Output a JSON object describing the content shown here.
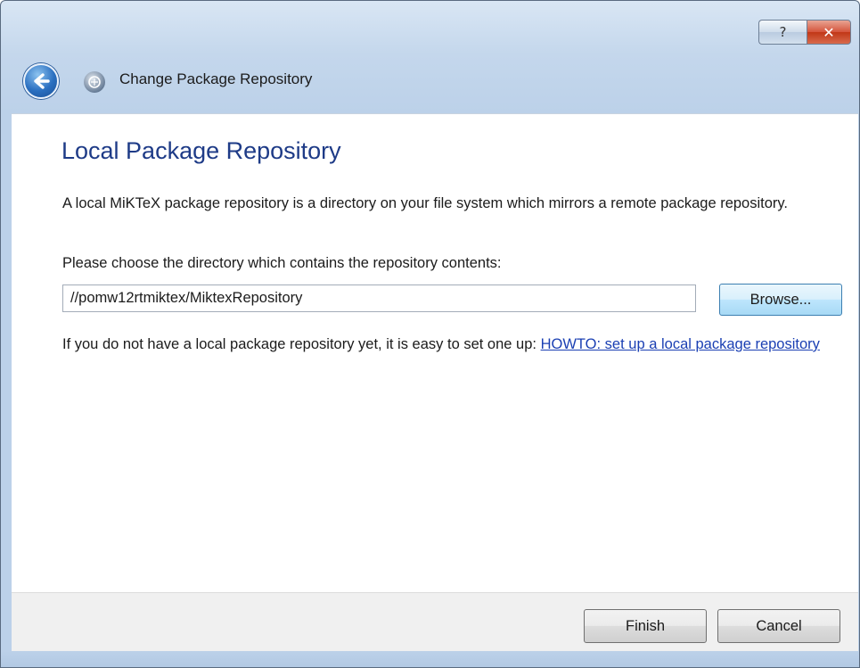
{
  "window": {
    "help_glyph": "?",
    "close_glyph": "✕"
  },
  "header": {
    "title": "Change Package Repository"
  },
  "main": {
    "heading": "Local Package Repository",
    "description": "A local MiKTeX package repository is a directory on your file system which mirrors a remote package repository.",
    "choose_label": "Please choose the directory which contains the repository contents:",
    "directory_value": "//pomw12rtmiktex/MiktexRepository",
    "browse_label": "Browse...",
    "info_text": "If you do not have a local package repository yet, it is easy to set one up: ",
    "howto_link": "HOWTO: set up a local package repository"
  },
  "footer": {
    "finish_label": "Finish",
    "cancel_label": "Cancel"
  },
  "colors": {
    "heading": "#1e3b87",
    "link": "#1a3fb3",
    "close_button": "#c13717"
  },
  "icons": {
    "back": "back-arrow-icon",
    "app": "miktex-icon",
    "help": "help-icon",
    "close": "close-icon"
  }
}
